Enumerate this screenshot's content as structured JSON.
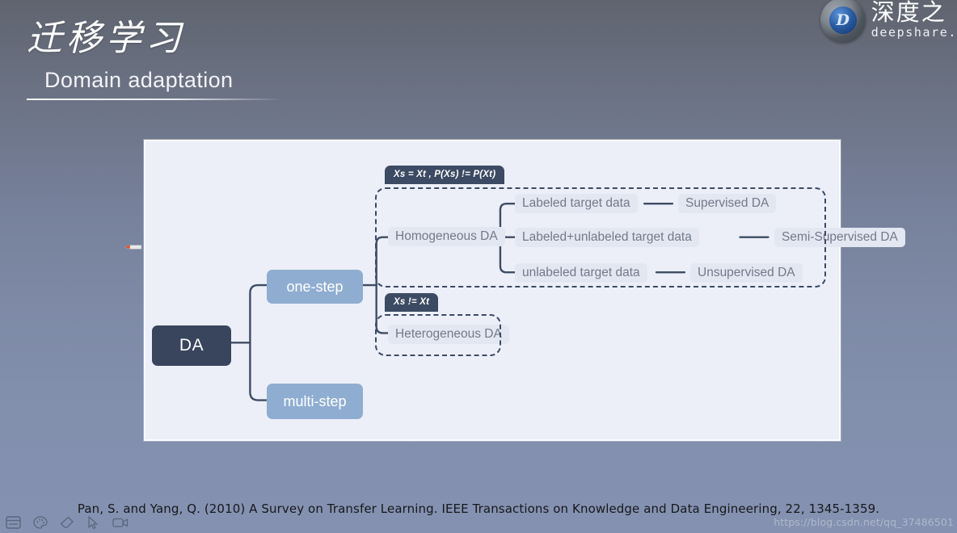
{
  "slide": {
    "title_cn": "迁移学习",
    "title_en": "Domain adaptation",
    "citation": "Pan, S. and Yang, Q. (2010) A Survey on Transfer Learning. IEEE Transactions on Knowledge and Data Engineering, 22, 1345-1359.",
    "watermark": "https://blog.csdn.net/qq_37486501"
  },
  "brand": {
    "logo_letter": "D",
    "name_cn": "深度之",
    "name_en": "deepshare."
  },
  "diagram": {
    "root": "DA",
    "branches": [
      {
        "label": "one-step"
      },
      {
        "label": "multi-step"
      }
    ],
    "tags": [
      {
        "id": "homogeneous-tag",
        "text": "Xs = Xt , P(Xs) != P(Xt)"
      },
      {
        "id": "heterogeneous-tag",
        "text": "Xs != Xt"
      }
    ],
    "groups": [
      {
        "id": "homogeneous",
        "label": "Homogeneous DA",
        "children": [
          {
            "data": "Labeled target data",
            "method": "Supervised DA"
          },
          {
            "data": "Labeled+unlabeled target data",
            "method": "Semi-Supervised DA"
          },
          {
            "data": "unlabeled target data",
            "method": "Unsupervised DA"
          }
        ]
      },
      {
        "id": "heterogeneous",
        "label": "Heterogeneous DA",
        "children": []
      }
    ]
  },
  "toolbar": {
    "items": [
      {
        "icon": "slide-panel-icon"
      },
      {
        "icon": "palette-icon"
      },
      {
        "icon": "eraser-icon"
      },
      {
        "icon": "cursor-icon"
      },
      {
        "icon": "video-camera-icon"
      }
    ]
  },
  "cursor": {
    "icon": "pen-cursor-icon"
  },
  "colors": {
    "bg_top": "#5f646f",
    "bg_bottom": "#8491b0",
    "panel": "#eceff8",
    "node_root": "#38455c",
    "node_blue": "#8fadd0",
    "tag": "#3c4a63",
    "link": "#3e4c63",
    "plain_text": "#74798b"
  }
}
